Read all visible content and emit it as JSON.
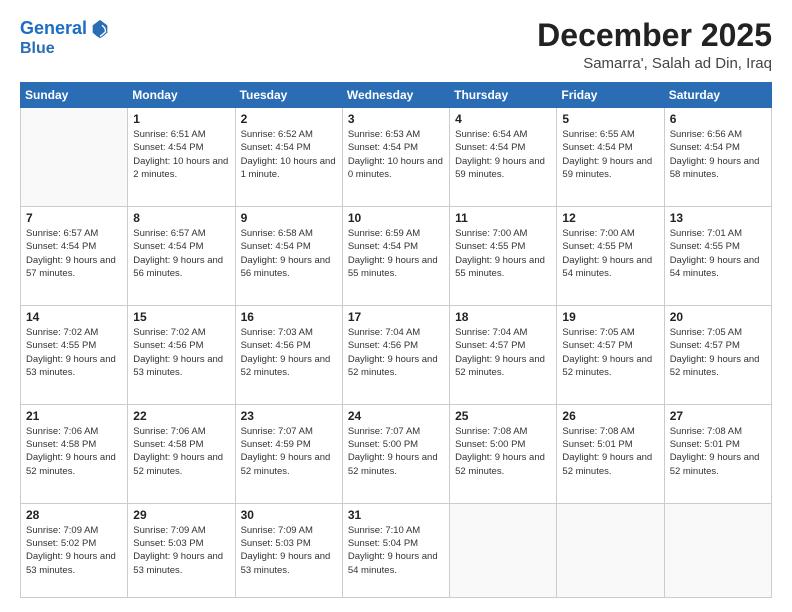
{
  "header": {
    "logo_line1": "General",
    "logo_line2": "Blue",
    "month": "December 2025",
    "location": "Samarra', Salah ad Din, Iraq"
  },
  "weekdays": [
    "Sunday",
    "Monday",
    "Tuesday",
    "Wednesday",
    "Thursday",
    "Friday",
    "Saturday"
  ],
  "weeks": [
    [
      {
        "day": "",
        "sunrise": "",
        "sunset": "",
        "daylight": ""
      },
      {
        "day": "1",
        "sunrise": "Sunrise: 6:51 AM",
        "sunset": "Sunset: 4:54 PM",
        "daylight": "Daylight: 10 hours and 2 minutes."
      },
      {
        "day": "2",
        "sunrise": "Sunrise: 6:52 AM",
        "sunset": "Sunset: 4:54 PM",
        "daylight": "Daylight: 10 hours and 1 minute."
      },
      {
        "day": "3",
        "sunrise": "Sunrise: 6:53 AM",
        "sunset": "Sunset: 4:54 PM",
        "daylight": "Daylight: 10 hours and 0 minutes."
      },
      {
        "day": "4",
        "sunrise": "Sunrise: 6:54 AM",
        "sunset": "Sunset: 4:54 PM",
        "daylight": "Daylight: 9 hours and 59 minutes."
      },
      {
        "day": "5",
        "sunrise": "Sunrise: 6:55 AM",
        "sunset": "Sunset: 4:54 PM",
        "daylight": "Daylight: 9 hours and 59 minutes."
      },
      {
        "day": "6",
        "sunrise": "Sunrise: 6:56 AM",
        "sunset": "Sunset: 4:54 PM",
        "daylight": "Daylight: 9 hours and 58 minutes."
      }
    ],
    [
      {
        "day": "7",
        "sunrise": "Sunrise: 6:57 AM",
        "sunset": "Sunset: 4:54 PM",
        "daylight": "Daylight: 9 hours and 57 minutes."
      },
      {
        "day": "8",
        "sunrise": "Sunrise: 6:57 AM",
        "sunset": "Sunset: 4:54 PM",
        "daylight": "Daylight: 9 hours and 56 minutes."
      },
      {
        "day": "9",
        "sunrise": "Sunrise: 6:58 AM",
        "sunset": "Sunset: 4:54 PM",
        "daylight": "Daylight: 9 hours and 56 minutes."
      },
      {
        "day": "10",
        "sunrise": "Sunrise: 6:59 AM",
        "sunset": "Sunset: 4:54 PM",
        "daylight": "Daylight: 9 hours and 55 minutes."
      },
      {
        "day": "11",
        "sunrise": "Sunrise: 7:00 AM",
        "sunset": "Sunset: 4:55 PM",
        "daylight": "Daylight: 9 hours and 55 minutes."
      },
      {
        "day": "12",
        "sunrise": "Sunrise: 7:00 AM",
        "sunset": "Sunset: 4:55 PM",
        "daylight": "Daylight: 9 hours and 54 minutes."
      },
      {
        "day": "13",
        "sunrise": "Sunrise: 7:01 AM",
        "sunset": "Sunset: 4:55 PM",
        "daylight": "Daylight: 9 hours and 54 minutes."
      }
    ],
    [
      {
        "day": "14",
        "sunrise": "Sunrise: 7:02 AM",
        "sunset": "Sunset: 4:55 PM",
        "daylight": "Daylight: 9 hours and 53 minutes."
      },
      {
        "day": "15",
        "sunrise": "Sunrise: 7:02 AM",
        "sunset": "Sunset: 4:56 PM",
        "daylight": "Daylight: 9 hours and 53 minutes."
      },
      {
        "day": "16",
        "sunrise": "Sunrise: 7:03 AM",
        "sunset": "Sunset: 4:56 PM",
        "daylight": "Daylight: 9 hours and 52 minutes."
      },
      {
        "day": "17",
        "sunrise": "Sunrise: 7:04 AM",
        "sunset": "Sunset: 4:56 PM",
        "daylight": "Daylight: 9 hours and 52 minutes."
      },
      {
        "day": "18",
        "sunrise": "Sunrise: 7:04 AM",
        "sunset": "Sunset: 4:57 PM",
        "daylight": "Daylight: 9 hours and 52 minutes."
      },
      {
        "day": "19",
        "sunrise": "Sunrise: 7:05 AM",
        "sunset": "Sunset: 4:57 PM",
        "daylight": "Daylight: 9 hours and 52 minutes."
      },
      {
        "day": "20",
        "sunrise": "Sunrise: 7:05 AM",
        "sunset": "Sunset: 4:57 PM",
        "daylight": "Daylight: 9 hours and 52 minutes."
      }
    ],
    [
      {
        "day": "21",
        "sunrise": "Sunrise: 7:06 AM",
        "sunset": "Sunset: 4:58 PM",
        "daylight": "Daylight: 9 hours and 52 minutes."
      },
      {
        "day": "22",
        "sunrise": "Sunrise: 7:06 AM",
        "sunset": "Sunset: 4:58 PM",
        "daylight": "Daylight: 9 hours and 52 minutes."
      },
      {
        "day": "23",
        "sunrise": "Sunrise: 7:07 AM",
        "sunset": "Sunset: 4:59 PM",
        "daylight": "Daylight: 9 hours and 52 minutes."
      },
      {
        "day": "24",
        "sunrise": "Sunrise: 7:07 AM",
        "sunset": "Sunset: 5:00 PM",
        "daylight": "Daylight: 9 hours and 52 minutes."
      },
      {
        "day": "25",
        "sunrise": "Sunrise: 7:08 AM",
        "sunset": "Sunset: 5:00 PM",
        "daylight": "Daylight: 9 hours and 52 minutes."
      },
      {
        "day": "26",
        "sunrise": "Sunrise: 7:08 AM",
        "sunset": "Sunset: 5:01 PM",
        "daylight": "Daylight: 9 hours and 52 minutes."
      },
      {
        "day": "27",
        "sunrise": "Sunrise: 7:08 AM",
        "sunset": "Sunset: 5:01 PM",
        "daylight": "Daylight: 9 hours and 52 minutes."
      }
    ],
    [
      {
        "day": "28",
        "sunrise": "Sunrise: 7:09 AM",
        "sunset": "Sunset: 5:02 PM",
        "daylight": "Daylight: 9 hours and 53 minutes."
      },
      {
        "day": "29",
        "sunrise": "Sunrise: 7:09 AM",
        "sunset": "Sunset: 5:03 PM",
        "daylight": "Daylight: 9 hours and 53 minutes."
      },
      {
        "day": "30",
        "sunrise": "Sunrise: 7:09 AM",
        "sunset": "Sunset: 5:03 PM",
        "daylight": "Daylight: 9 hours and 53 minutes."
      },
      {
        "day": "31",
        "sunrise": "Sunrise: 7:10 AM",
        "sunset": "Sunset: 5:04 PM",
        "daylight": "Daylight: 9 hours and 54 minutes."
      },
      {
        "day": "",
        "sunrise": "",
        "sunset": "",
        "daylight": ""
      },
      {
        "day": "",
        "sunrise": "",
        "sunset": "",
        "daylight": ""
      },
      {
        "day": "",
        "sunrise": "",
        "sunset": "",
        "daylight": ""
      }
    ]
  ]
}
